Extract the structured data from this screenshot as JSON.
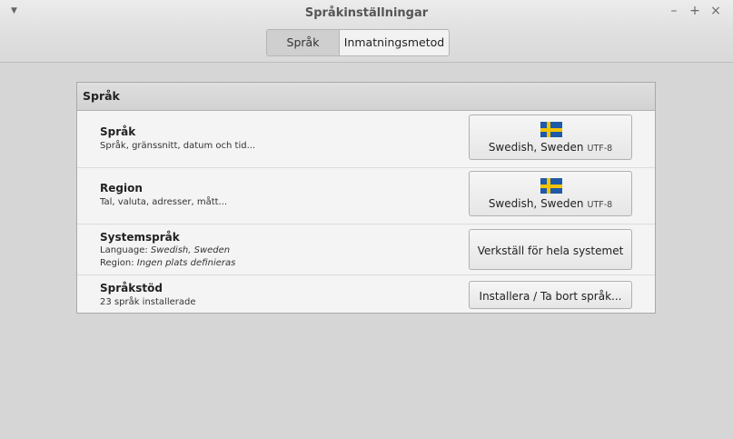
{
  "window": {
    "title": "Språkinställningar",
    "controls": {
      "minimize": "–",
      "maximize": "+",
      "close": "×"
    }
  },
  "tabs": [
    {
      "label": "Språk",
      "active": true
    },
    {
      "label": "Inmatningsmetod",
      "active": false
    }
  ],
  "panel": {
    "header": "Språk",
    "rows": [
      {
        "title": "Språk",
        "subtitle": "Språk, gränssnitt, datum och tid...",
        "button": {
          "label": "Swedish, Sweden",
          "encoding": "UTF-8",
          "icon": "sweden-flag-icon"
        }
      },
      {
        "title": "Region",
        "subtitle": "Tal, valuta, adresser, mått...",
        "button": {
          "label": "Swedish, Sweden",
          "encoding": "UTF-8",
          "icon": "sweden-flag-icon"
        }
      },
      {
        "title": "Systemspråk",
        "lines": [
          {
            "prefix": "Language: ",
            "value": "Swedish, Sweden"
          },
          {
            "prefix": "Region: ",
            "value": "Ingen plats definieras"
          }
        ],
        "button": {
          "label": "Verkställ för hela systemet"
        }
      },
      {
        "title": "Språkstöd",
        "subtitle": "23 språk installerade",
        "button": {
          "label": "Installera / Ta bort språk..."
        }
      }
    ]
  }
}
